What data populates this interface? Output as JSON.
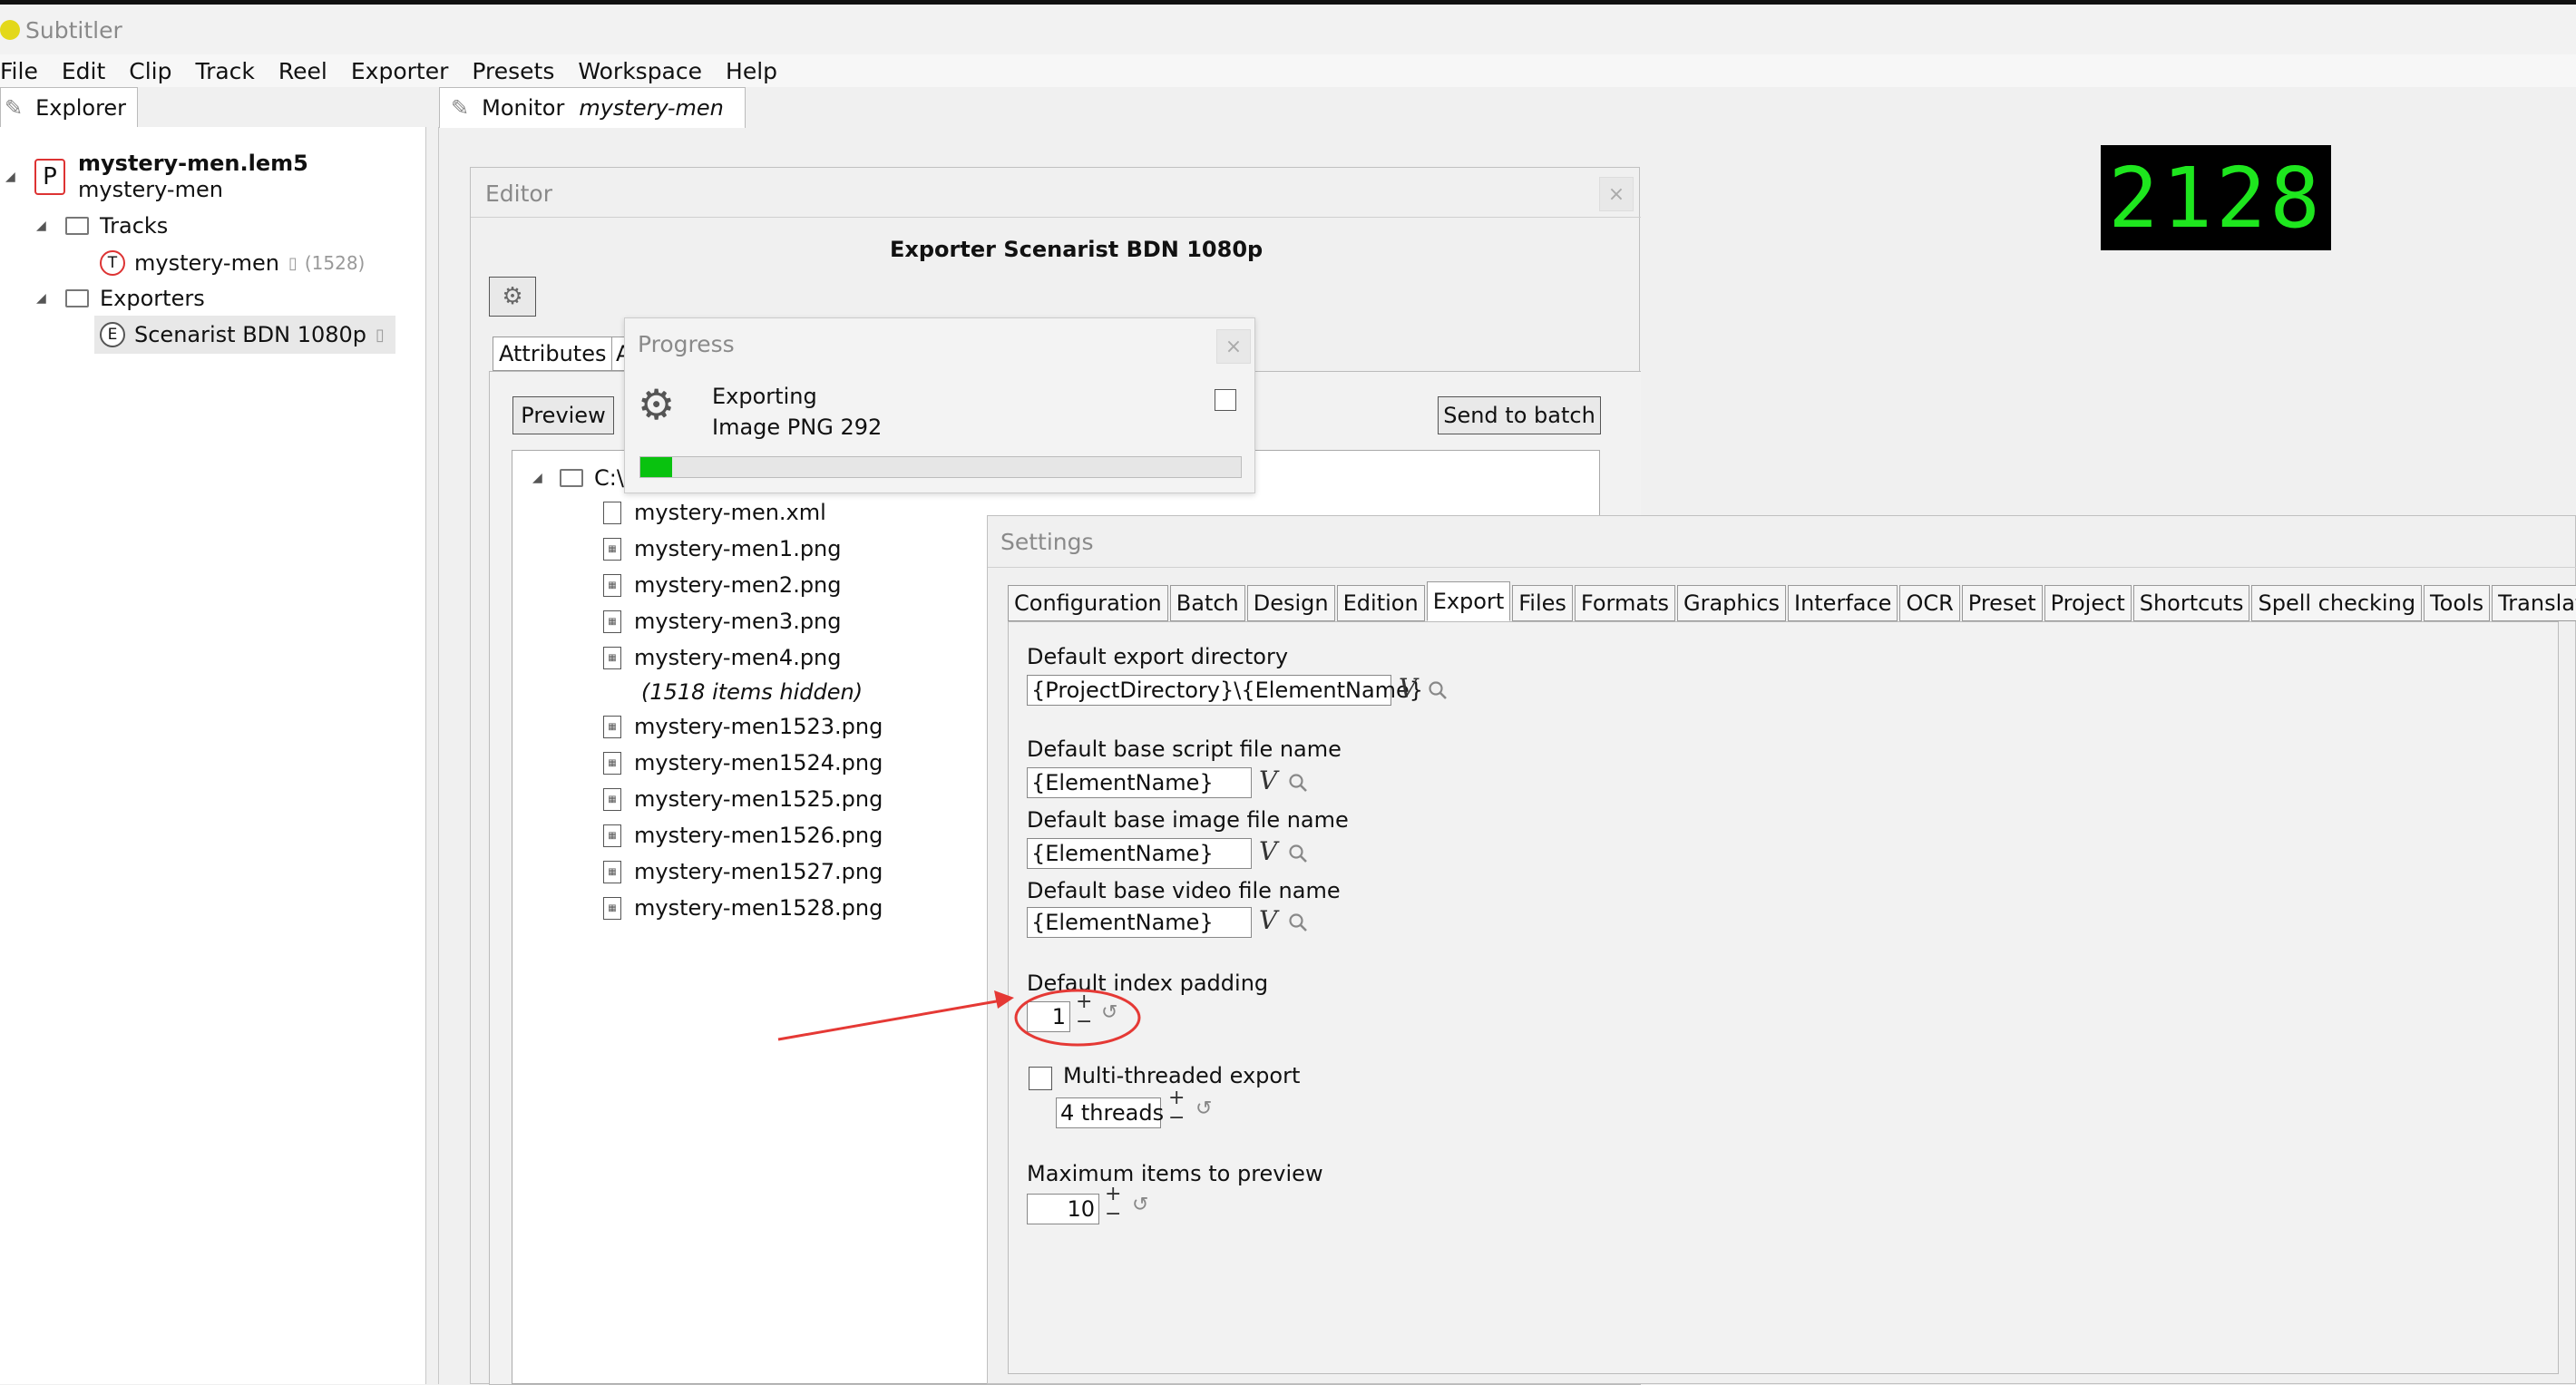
{
  "app": {
    "title": "Subtitler"
  },
  "menu": [
    "File",
    "Edit",
    "Clip",
    "Track",
    "Reel",
    "Exporter",
    "Presets",
    "Workspace",
    "Help"
  ],
  "explorer": {
    "tab_label": "Explorer",
    "project_badge": "P",
    "project_file": "mystery-men.lem5",
    "project_name": "mystery-men",
    "tracks_label": "Tracks",
    "track_badge": "T",
    "track_name": "mystery-men",
    "track_count": "(1528)",
    "exporters_label": "Exporters",
    "exporter_badge": "E",
    "exporter_name": "Scenarist BDN 1080p"
  },
  "monitor": {
    "tab_label": "Monitor",
    "tab_sub": "mystery-men",
    "counter": "2128"
  },
  "editor": {
    "title": "Editor",
    "close": "×",
    "heading": "Exporter Scenarist BDN 1080p",
    "attributes_tab": "Attributes",
    "attributes_tab2": "A",
    "preview_button": "Preview",
    "send_to_batch_button": "Send to batch",
    "root_folder": "C:\\",
    "files": [
      "mystery-men.xml",
      "mystery-men1.png",
      "mystery-men2.png",
      "mystery-men3.png",
      "mystery-men4.png"
    ],
    "hidden_note": "(1518 items hidden)",
    "files_after": [
      "mystery-men1523.png",
      "mystery-men1524.png",
      "mystery-men1525.png",
      "mystery-men1526.png",
      "mystery-men1527.png",
      "mystery-men1528.png"
    ]
  },
  "progress": {
    "title": "Progress",
    "close": "×",
    "line1": "Exporting",
    "line2": "Image PNG 292",
    "fraction": 0.053
  },
  "settings": {
    "title": "Settings",
    "tabs": [
      "Configuration",
      "Batch",
      "Design",
      "Edition",
      "Export",
      "Files",
      "Formats",
      "Graphics",
      "Interface",
      "OCR",
      "Preset",
      "Project",
      "Shortcuts",
      "Spell checking",
      "Tools",
      "Translator"
    ],
    "active_tab": "Export",
    "export_dir_label": "Default export directory",
    "export_dir_value": "{ProjectDirectory}\\{ElementName}",
    "script_label": "Default base script file name",
    "script_value": "{ElementName}",
    "image_label": "Default base image file name",
    "image_value": "{ElementName}",
    "video_label": "Default base video file name",
    "video_value": "{ElementName}",
    "padding_label": "Default index padding",
    "padding_value": "1",
    "multithread_label": "Multi-threaded export",
    "threads_value": "4 threads",
    "max_preview_label": "Maximum items to preview",
    "max_preview_value": "10",
    "v_symbol": "V",
    "plus": "+",
    "minus": "−",
    "reset_glyph": "↺"
  },
  "colors": {
    "counter_text": "#1ee61e",
    "progress_fill": "#09c20f",
    "annotation": "#e53935"
  }
}
